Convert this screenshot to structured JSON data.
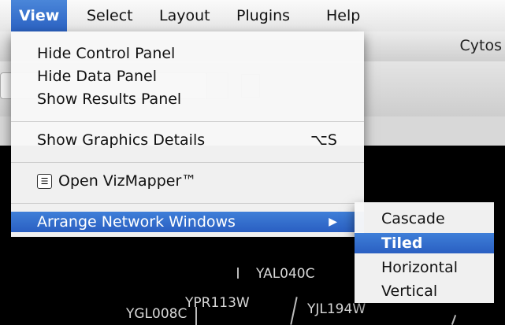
{
  "menubar": {
    "items": [
      "View",
      "Select",
      "Layout",
      "Plugins",
      "Help"
    ]
  },
  "background_window": {
    "title": "Cytos"
  },
  "view_menu": {
    "items": [
      {
        "label": "Hide Control Panel"
      },
      {
        "label": "Hide Data Panel"
      },
      {
        "label": "Show Results Panel"
      },
      {
        "label": "Show Graphics Details",
        "shortcut": "⌥S"
      },
      {
        "label": "Open VizMapper™"
      },
      {
        "label": "Arrange Network Windows"
      }
    ]
  },
  "arrange_submenu": {
    "items": [
      "Cascade",
      "Tiled",
      "Horizontal",
      "Vertical"
    ],
    "selected": "Tiled"
  },
  "network": {
    "nodes": [
      "YAL040C",
      "YPR113W",
      "YGL008C",
      "YJL194W"
    ]
  },
  "colors": {
    "highlight": "#2f6bd0",
    "network_background": "#000000"
  }
}
